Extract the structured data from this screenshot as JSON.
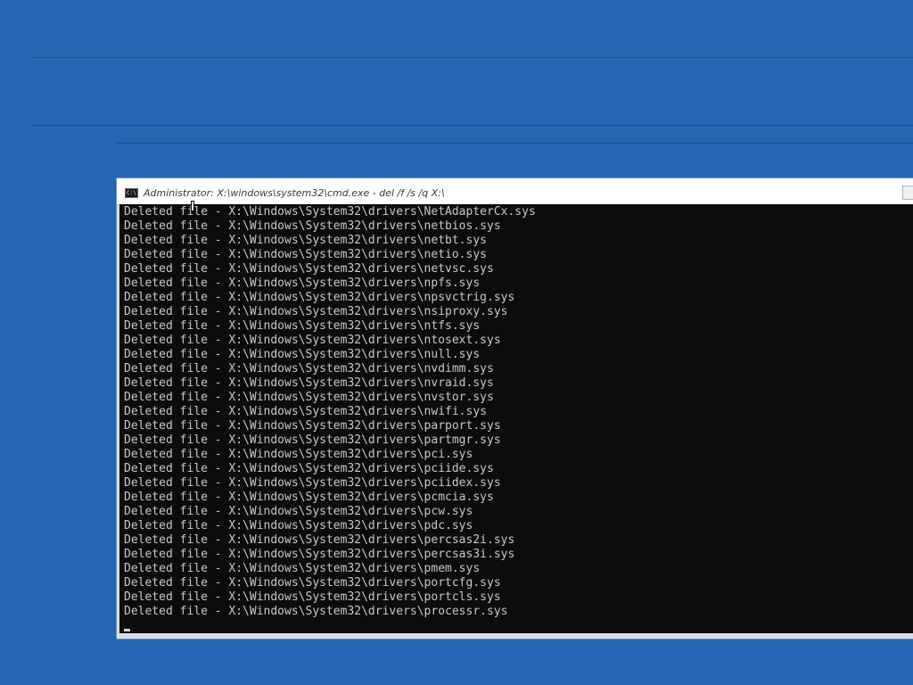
{
  "window": {
    "title": "Administrator: X:\\windows\\system32\\cmd.exe - del  /f /s /q X:\\",
    "icon": "cmd-console-icon",
    "icon_label": "C:\\"
  },
  "console": {
    "lines": [
      "Deleted file - X:\\Windows\\System32\\drivers\\NetAdapterCx.sys",
      "Deleted file - X:\\Windows\\System32\\drivers\\netbios.sys",
      "Deleted file - X:\\Windows\\System32\\drivers\\netbt.sys",
      "Deleted file - X:\\Windows\\System32\\drivers\\netio.sys",
      "Deleted file - X:\\Windows\\System32\\drivers\\netvsc.sys",
      "Deleted file - X:\\Windows\\System32\\drivers\\npfs.sys",
      "Deleted file - X:\\Windows\\System32\\drivers\\npsvctrig.sys",
      "Deleted file - X:\\Windows\\System32\\drivers\\nsiproxy.sys",
      "Deleted file - X:\\Windows\\System32\\drivers\\ntfs.sys",
      "Deleted file - X:\\Windows\\System32\\drivers\\ntosext.sys",
      "Deleted file - X:\\Windows\\System32\\drivers\\null.sys",
      "Deleted file - X:\\Windows\\System32\\drivers\\nvdimm.sys",
      "Deleted file - X:\\Windows\\System32\\drivers\\nvraid.sys",
      "Deleted file - X:\\Windows\\System32\\drivers\\nvstor.sys",
      "Deleted file - X:\\Windows\\System32\\drivers\\nwifi.sys",
      "Deleted file - X:\\Windows\\System32\\drivers\\parport.sys",
      "Deleted file - X:\\Windows\\System32\\drivers\\partmgr.sys",
      "Deleted file - X:\\Windows\\System32\\drivers\\pci.sys",
      "Deleted file - X:\\Windows\\System32\\drivers\\pciide.sys",
      "Deleted file - X:\\Windows\\System32\\drivers\\pciidex.sys",
      "Deleted file - X:\\Windows\\System32\\drivers\\pcmcia.sys",
      "Deleted file - X:\\Windows\\System32\\drivers\\pcw.sys",
      "Deleted file - X:\\Windows\\System32\\drivers\\pdc.sys",
      "Deleted file - X:\\Windows\\System32\\drivers\\percsas2i.sys",
      "Deleted file - X:\\Windows\\System32\\drivers\\percsas3i.sys",
      "Deleted file - X:\\Windows\\System32\\drivers\\pmem.sys",
      "Deleted file - X:\\Windows\\System32\\drivers\\portcfg.sys",
      "Deleted file - X:\\Windows\\System32\\drivers\\portcls.sys",
      "Deleted file - X:\\Windows\\System32\\drivers\\processr.sys"
    ]
  },
  "colors": {
    "desktop": "#2467b3",
    "console_bg": "#0c0c0c",
    "console_text": "#c8c8c8"
  }
}
